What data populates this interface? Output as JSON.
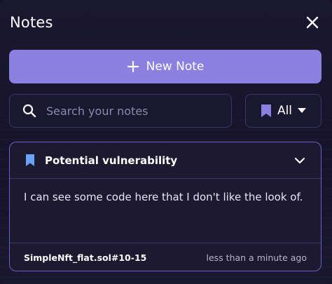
{
  "header": {
    "title": "Notes",
    "close_icon": "close-icon"
  },
  "actions": {
    "new_note_label": "New Note",
    "new_note_icon": "plus-icon"
  },
  "search": {
    "placeholder": "Search your notes",
    "value": "",
    "icon": "search-icon"
  },
  "filter": {
    "label": "All",
    "icon": "bookmark-icon",
    "dropdown_icon": "caret-down-icon"
  },
  "notes": [
    {
      "title": "Potential vulnerability",
      "body": "I can see some code here that I don't like the look of.",
      "reference": "SimpleNft_flat.sol#10-15",
      "timestamp": "less than a minute ago",
      "bookmark_color": "#6aa3f5"
    }
  ],
  "colors": {
    "accent": "#8b7fe0",
    "background": "#171427",
    "border": "#3b3766",
    "card_border": "#6c60c9",
    "filter_bookmark": "#8b7fe0"
  }
}
